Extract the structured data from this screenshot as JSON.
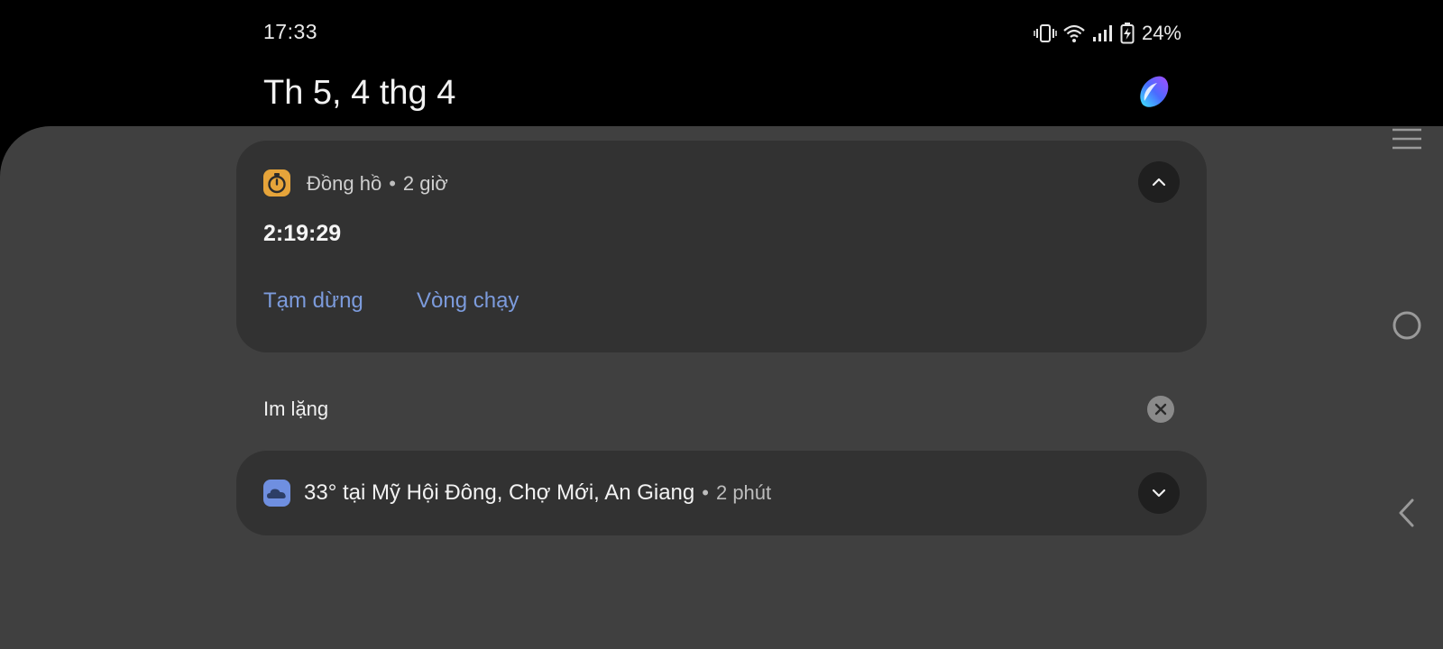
{
  "status_bar": {
    "time": "17:33",
    "battery_percent": "24%",
    "icons": [
      "vibrate-icon",
      "wifi-icon",
      "signal-icon",
      "battery-charging-icon"
    ]
  },
  "header": {
    "date": "Th 5, 4 thg 4",
    "assistant_icon": "bixby-icon"
  },
  "notifications": {
    "clock": {
      "app_name": "Đồng hồ",
      "time_ago": "2 giờ",
      "timer_value": "2:19:29",
      "actions": [
        "Tạm dừng",
        "Vòng chạy"
      ],
      "icon": "stopwatch-icon",
      "icon_color": "#e6a43a"
    },
    "silent_section": {
      "label": "Im lặng"
    },
    "weather": {
      "title": "33° tại Mỹ Hội Đông, Chợ Mới, An Giang",
      "time_ago": "2 phút",
      "icon": "weather-cloud-icon",
      "icon_color": "#6f8fe0"
    }
  },
  "navigation": {
    "buttons": [
      "recents-icon",
      "home-icon",
      "back-icon"
    ]
  },
  "colors": {
    "panel_bg": "#404040",
    "card_bg": "#323232",
    "action_text": "#7c9bdc"
  }
}
